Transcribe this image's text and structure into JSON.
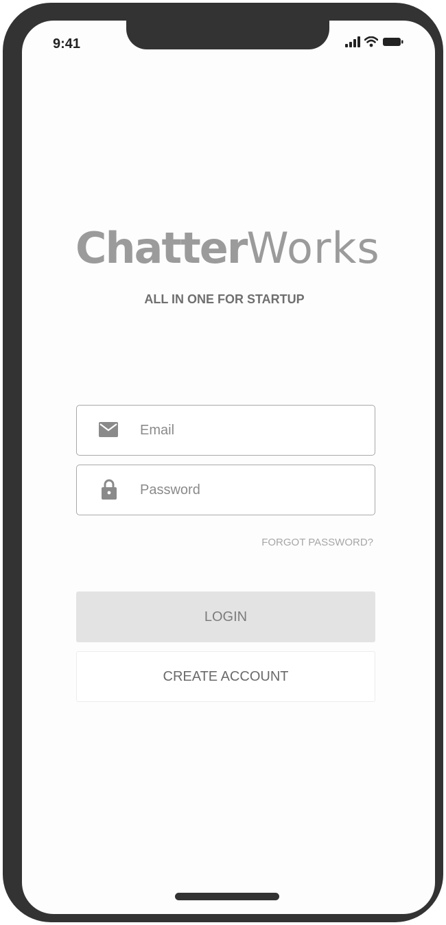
{
  "status_bar": {
    "time": "9:41",
    "icons": [
      "signal-icon",
      "wifi-icon",
      "battery-icon"
    ]
  },
  "brand": {
    "name_bold": "Chatter",
    "name_light": "Works",
    "tagline": "ALL IN ONE FOR STARTUP"
  },
  "form": {
    "email": {
      "placeholder": "Email",
      "value": "",
      "icon": "mail-icon"
    },
    "password": {
      "placeholder": "Password",
      "value": "",
      "icon": "lock-icon"
    },
    "forgot_label": "FORGOT PASSWORD?"
  },
  "buttons": {
    "login_label": "LOGIN",
    "create_label": "CREATE ACCOUNT"
  },
  "colors": {
    "frame": "#333333",
    "brand_gray": "#9b9b9b",
    "login_bg": "#e3e3e3"
  }
}
